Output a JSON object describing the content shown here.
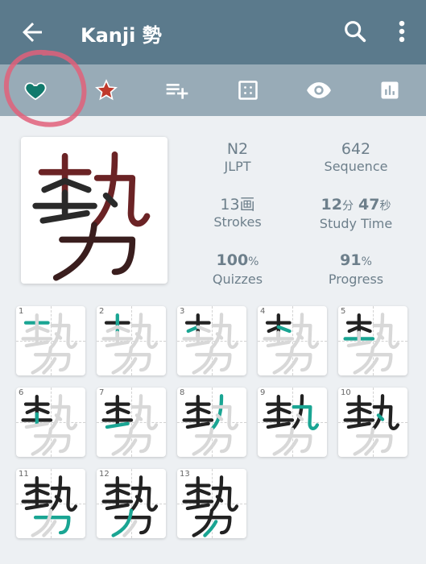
{
  "appbar": {
    "title": "Kanji 勢",
    "back_icon": "arrow-left-icon",
    "search_icon": "search-icon",
    "more_icon": "more-vertical-icon"
  },
  "toolbar": {
    "items": [
      {
        "name": "favorite",
        "icon": "heart-icon"
      },
      {
        "name": "star",
        "icon": "star-icon"
      },
      {
        "name": "add-to-list",
        "icon": "playlist-add-icon"
      },
      {
        "name": "grid",
        "icon": "grid-icon"
      },
      {
        "name": "view",
        "icon": "eye-icon"
      },
      {
        "name": "stats",
        "icon": "bar-chart-icon"
      }
    ]
  },
  "kanji": {
    "character": "勢"
  },
  "stats": {
    "jlpt_value": "N2",
    "jlpt_label": "JLPT",
    "sequence_value": "642",
    "sequence_label": "Sequence",
    "strokes_value": "13画",
    "strokes_label": "Strokes",
    "study_minutes": "12",
    "study_minutes_unit": "分",
    "study_seconds": "47",
    "study_seconds_unit": "秒",
    "study_label": "Study Time",
    "quizzes_value": "100",
    "quizzes_unit": "%",
    "quizzes_label": "Quizzes",
    "progress_value": "91",
    "progress_unit": "%",
    "progress_label": "Progress"
  },
  "stroke_order": {
    "numbers": [
      "1",
      "2",
      "3",
      "4",
      "5",
      "6",
      "7",
      "8",
      "9",
      "10",
      "11",
      "12",
      "13"
    ]
  },
  "colors": {
    "appbar": "#5b7a8c",
    "toolbar": "#98abb7",
    "accent_teal": "#1aa593",
    "star_red": "#c0392b",
    "annotation_circle": "#e0607a"
  }
}
